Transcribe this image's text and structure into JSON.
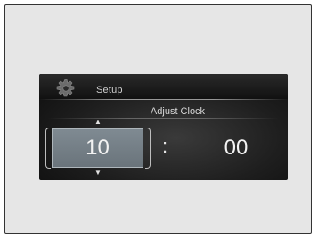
{
  "header": {
    "icon": "gear-icon",
    "title": "Setup"
  },
  "screen": {
    "subtitle": "Adjust Clock"
  },
  "clock": {
    "hour": "10",
    "separator": ":",
    "minute": "00",
    "up_arrow": "▲",
    "down_arrow": "▼"
  },
  "colors": {
    "screen_background": "#1e1e1e",
    "selected_field": "#74808a",
    "text": "#f2f2f2"
  }
}
